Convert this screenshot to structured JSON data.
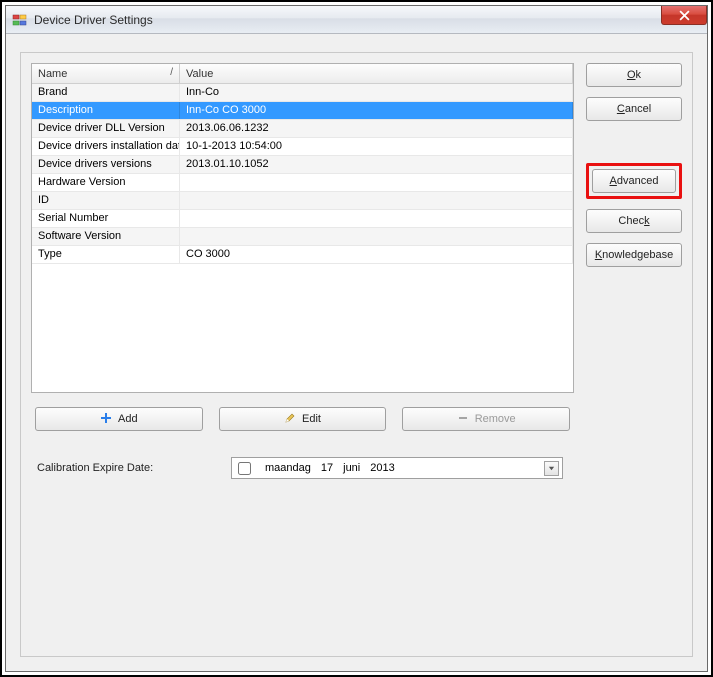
{
  "window": {
    "title": "Device Driver Settings"
  },
  "grid": {
    "header_name": "Name",
    "header_value": "Value",
    "rows": [
      {
        "name": "Brand",
        "value": "Inn-Co"
      },
      {
        "name": "Description",
        "value": "Inn-Co CO 3000"
      },
      {
        "name": "Device driver DLL Version",
        "value": "2013.06.06.1232"
      },
      {
        "name": "Device drivers installation date",
        "value": "10-1-2013 10:54:00"
      },
      {
        "name": "Device drivers versions",
        "value": "2013.01.10.1052"
      },
      {
        "name": "Hardware Version",
        "value": ""
      },
      {
        "name": "ID",
        "value": ""
      },
      {
        "name": "Serial Number",
        "value": ""
      },
      {
        "name": "Software Version",
        "value": ""
      },
      {
        "name": "Type",
        "value": "CO 3000"
      }
    ],
    "selected_index": 1
  },
  "bottom_buttons": {
    "add": "Add",
    "edit": "Edit",
    "remove": "Remove"
  },
  "calibration": {
    "label": "Calibration Expire Date:",
    "checked": false,
    "weekday": "maandag",
    "day": "17",
    "month": "juni",
    "year": "2013"
  },
  "side_buttons": {
    "ok": "Ok",
    "cancel": "Cancel",
    "advanced": "Advanced",
    "check": "Check",
    "knowledgebase": "Knowledgebase"
  }
}
